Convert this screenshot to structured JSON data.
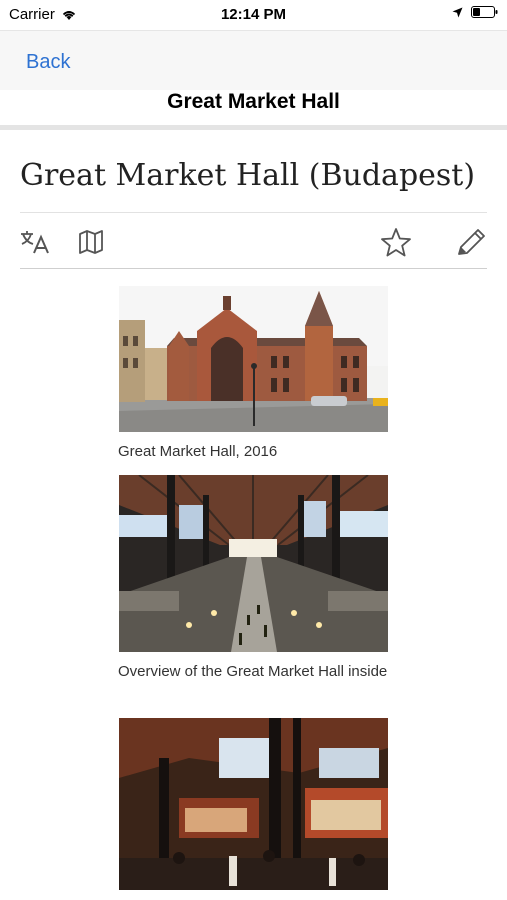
{
  "status_bar": {
    "carrier": "Carrier",
    "time": "12:14 PM",
    "icons": [
      "wifi-icon",
      "location-arrow-icon",
      "battery-icon"
    ]
  },
  "nav": {
    "back_label": "Back",
    "title": "Great Market Hall",
    "accent_color": "#2e72d2"
  },
  "article": {
    "title": "Great Market Hall (Budapest)",
    "toolbar": [
      "translate-icon",
      "map-icon",
      "star-icon",
      "edit-pencil-icon"
    ],
    "figures": [
      {
        "image": "exterior-photo",
        "caption": "Great Market Hall, 2016"
      },
      {
        "image": "interior-photo",
        "caption": "Overview of the Great Market Hall inside"
      },
      {
        "image": "stalls-photo",
        "caption": ""
      }
    ]
  }
}
